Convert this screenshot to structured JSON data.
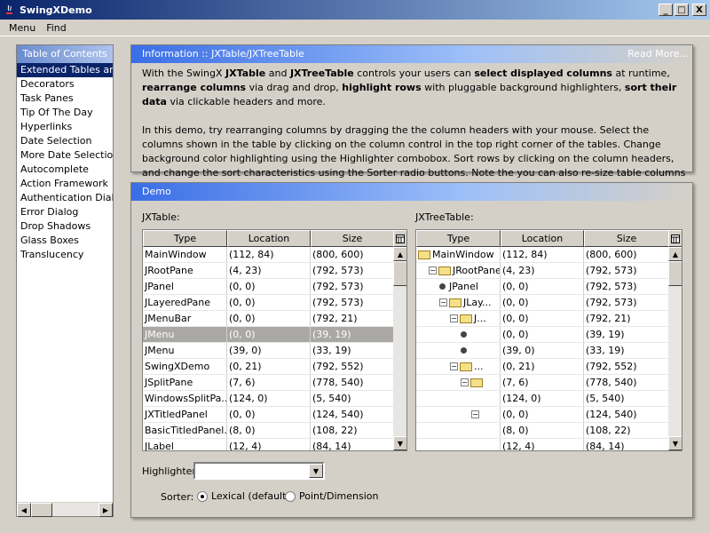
{
  "window": {
    "title": "SwingXDemo",
    "buttons": [
      "_",
      "□",
      "X"
    ]
  },
  "menu": [
    "Menu",
    "Find"
  ],
  "toc": {
    "title": "Table of Contents",
    "items": [
      "Extended Tables and",
      "Decorators",
      "Task Panes",
      "Tip Of The Day",
      "Hyperlinks",
      "Date Selection",
      "More Date Selection",
      "Autocomplete",
      "Action Framework",
      "Authentication Dialogs",
      "Error Dialog",
      "Drop Shadows",
      "Glass Boxes",
      "Translucency"
    ],
    "selected": 0
  },
  "info": {
    "title": "Information :: JXTable/JXTreeTable",
    "read_more": "Read More..."
  },
  "demo": {
    "title": "Demo",
    "jxtable_label": "JXTable:",
    "jxtreetable_label": "JXTreeTable:",
    "highlighter_label": "Highlighter:",
    "sorter_label": "Sorter:",
    "sorter_options": [
      "Lexical (default)",
      "Point/Dimension"
    ],
    "sorter_selected": 0
  },
  "columns": [
    "Type",
    "Location",
    "Size"
  ],
  "jxtable_rows": [
    [
      "MainWindow",
      "(112, 84)",
      "(800, 600)"
    ],
    [
      "JRootPane",
      "(4, 23)",
      "(792, 573)"
    ],
    [
      "JPanel",
      "(0, 0)",
      "(792, 573)"
    ],
    [
      "JLayeredPane",
      "(0, 0)",
      "(792, 573)"
    ],
    [
      "JMenuBar",
      "(0, 0)",
      "(792, 21)"
    ],
    [
      "JMenu",
      "(0, 0)",
      "(39, 19)"
    ],
    [
      "JMenu",
      "(39, 0)",
      "(33, 19)"
    ],
    [
      "SwingXDemo",
      "(0, 21)",
      "(792, 552)"
    ],
    [
      "JSplitPane",
      "(7, 6)",
      "(778, 540)"
    ],
    [
      "WindowsSplitPa...",
      "(124, 0)",
      "(5, 540)"
    ],
    [
      "JXTitledPanel",
      "(0, 0)",
      "(124, 540)"
    ],
    [
      "BasicTitledPanel...",
      "(8, 0)",
      "(108, 22)"
    ],
    [
      "JLabel",
      "(12, 4)",
      "(84, 14)"
    ]
  ],
  "jxtable_selected": 5,
  "tree_rows": [
    {
      "label": "MainWindow",
      "loc": "(112, 84)",
      "size": "(800, 600)",
      "depth": 0,
      "kind": "folder",
      "exp": ""
    },
    {
      "label": "JRootPane",
      "loc": "(4, 23)",
      "size": "(792, 573)",
      "depth": 1,
      "kind": "folder",
      "exp": "−"
    },
    {
      "label": "JPanel",
      "loc": "(0, 0)",
      "size": "(792, 573)",
      "depth": 2,
      "kind": "leaf",
      "exp": ""
    },
    {
      "label": "JLay...",
      "loc": "(0, 0)",
      "size": "(792, 573)",
      "depth": 2,
      "kind": "folder",
      "exp": "−"
    },
    {
      "label": "J...",
      "loc": "(0, 0)",
      "size": "(792, 21)",
      "depth": 3,
      "kind": "folder",
      "exp": "−"
    },
    {
      "label": "",
      "loc": "(0, 0)",
      "size": "(39, 19)",
      "depth": 4,
      "kind": "leaf",
      "exp": ""
    },
    {
      "label": "",
      "loc": "(39, 0)",
      "size": "(33, 19)",
      "depth": 4,
      "kind": "leaf",
      "exp": ""
    },
    {
      "label": "...",
      "loc": "(0, 21)",
      "size": "(792, 552)",
      "depth": 3,
      "kind": "folder",
      "exp": "−"
    },
    {
      "label": "",
      "loc": "(7, 6)",
      "size": "(778, 540)",
      "depth": 4,
      "kind": "folder",
      "exp": "−"
    },
    {
      "label": "",
      "loc": "(124, 0)",
      "size": "(5, 540)",
      "depth": 5,
      "kind": "none",
      "exp": ""
    },
    {
      "label": "",
      "loc": "(0, 0)",
      "size": "(124, 540)",
      "depth": 5,
      "kind": "none",
      "exp": "−"
    },
    {
      "label": "",
      "loc": "(8, 0)",
      "size": "(108, 22)",
      "depth": 5,
      "kind": "none",
      "exp": ""
    },
    {
      "label": "",
      "loc": "(12, 4)",
      "size": "(84, 14)",
      "depth": 5,
      "kind": "none",
      "exp": ""
    }
  ]
}
